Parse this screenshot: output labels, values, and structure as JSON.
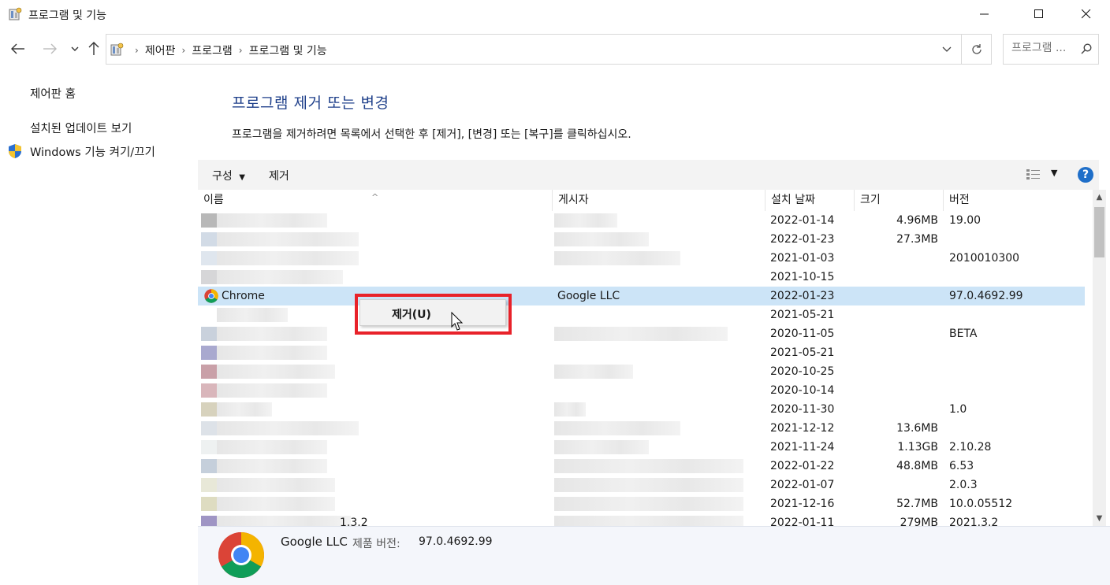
{
  "window": {
    "title": "프로그램 및 기능",
    "minimize_icon": "minimize-icon",
    "maximize_icon": "maximize-icon",
    "close_icon": "close-icon"
  },
  "address": {
    "crumbs": [
      "제어판",
      "프로그램",
      "프로그램 및 기능"
    ],
    "search_placeholder": "프로그램 ..."
  },
  "left_pane": {
    "links": [
      "제어판 홈",
      "설치된 업데이트 보기",
      "Windows 기능 켜기/끄기"
    ]
  },
  "main": {
    "title": "프로그램 제거 또는 변경",
    "description": "프로그램을 제거하려면 목록에서 선택한 후 [제거], [변경] 또는 [복구]를 클릭하십시오."
  },
  "toolbar": {
    "organize": "구성",
    "remove": "제거",
    "help": "?"
  },
  "columns": [
    "이름",
    "게시자",
    "설치 날짜",
    "크기",
    "버전"
  ],
  "rows": [
    {
      "name": "",
      "publisher": "",
      "date": "2022-01-14",
      "size": "4.96MB",
      "version": "19.00"
    },
    {
      "name": "",
      "publisher": "",
      "date": "2022-01-23",
      "size": "27.3MB",
      "version": ""
    },
    {
      "name": "",
      "publisher": "",
      "date": "2021-01-03",
      "size": "",
      "version": "2010010300"
    },
    {
      "name": "",
      "publisher": "",
      "date": "2021-10-15",
      "size": "",
      "version": ""
    },
    {
      "name": "Chrome",
      "publisher": "Google LLC",
      "date": "2022-01-23",
      "size": "",
      "version": "97.0.4692.99",
      "selected": true
    },
    {
      "name": "",
      "publisher": "",
      "date": "2021-05-21",
      "size": "",
      "version": ""
    },
    {
      "name": "",
      "publisher": "",
      "date": "2020-11-05",
      "size": "",
      "version": "BETA"
    },
    {
      "name": "",
      "publisher": "",
      "date": "2021-05-21",
      "size": "",
      "version": ""
    },
    {
      "name": "",
      "publisher": "",
      "date": "2020-10-25",
      "size": "",
      "version": ""
    },
    {
      "name": "",
      "publisher": "",
      "date": "2020-10-14",
      "size": "",
      "version": ""
    },
    {
      "name": "",
      "publisher": "",
      "date": "2020-11-30",
      "size": "",
      "version": "1.0"
    },
    {
      "name": "",
      "publisher": "",
      "date": "2021-12-12",
      "size": "13.6MB",
      "version": ""
    },
    {
      "name": "",
      "publisher": "",
      "date": "2021-11-24",
      "size": "1.13GB",
      "version": "2.10.28"
    },
    {
      "name": "",
      "publisher": "",
      "date": "2022-01-22",
      "size": "48.8MB",
      "version": "6.53"
    },
    {
      "name": "",
      "publisher": "",
      "date": "2022-01-07",
      "size": "",
      "version": "2.0.3"
    },
    {
      "name": "",
      "publisher": "",
      "date": "2021-12-16",
      "size": "52.7MB",
      "version": "10.0.05512"
    },
    {
      "name": "1.3.2",
      "publisher": "",
      "date": "2022-01-11",
      "size": "279MB",
      "version": "2021.3.2"
    }
  ],
  "context_menu": {
    "item": "제거(U)"
  },
  "details": {
    "publisher": "Google LLC",
    "label": "제품 버전:",
    "version": "97.0.4692.99"
  },
  "colors": {
    "title_blue": "#1e3f8a",
    "selection": "#cce4f7",
    "highlight_red": "#e8222a"
  }
}
